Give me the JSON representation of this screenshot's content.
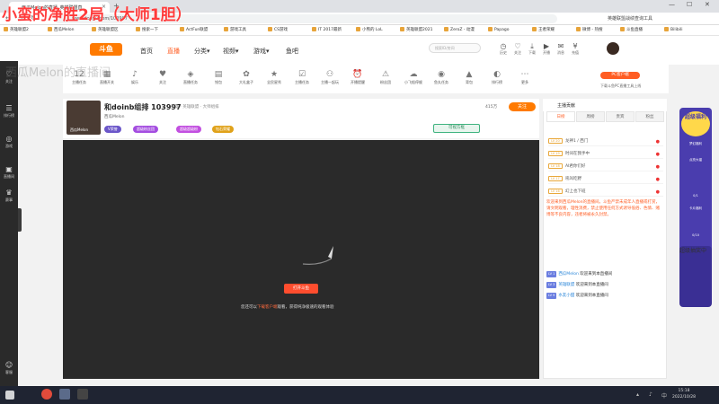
{
  "overlay": {
    "title": "小蛮的净胜2局（大师1胆）"
  },
  "browser": {
    "tab_title": "西瓜Melon的直播_英雄联盟直",
    "url": "www.douyu.com/103997",
    "search_hint": "英雄联盟战绩查询工具",
    "new_tab": "+",
    "close_glyph": "×",
    "minimize": "—",
    "maximize": "☐",
    "close_window": "✕"
  },
  "bookmarks": [
    "英雄联盟2",
    "西瓜Melon",
    "英雄联盟区",
    "搜索一下",
    "ActFun联盟",
    "游戏工具",
    "CS游戏",
    "IT 2017最新",
    "小熊的 LoL",
    "英雄联盟2021",
    "ZeroZ - 动漫",
    "Papago",
    "王者荣耀",
    "微博 - 热搜",
    "斗鱼直播",
    "Bilibili"
  ],
  "site": {
    "logo": "斗鱼",
    "nav": [
      "首页",
      "直播",
      "分类▾",
      "视频▾",
      "游戏▾",
      "鱼吧"
    ],
    "search_placeholder": "搜索ID/房间",
    "header_icons": [
      {
        "label": "历史",
        "glyph": "◷"
      },
      {
        "label": "关注",
        "glyph": "♡"
      },
      {
        "label": "下载",
        "glyph": "⤓"
      },
      {
        "label": "开播",
        "glyph": "▶"
      },
      {
        "label": "消息",
        "glyph": "✉"
      },
      {
        "label": "充值",
        "glyph": "¥"
      }
    ]
  },
  "sidebar": [
    {
      "label": "关注",
      "glyph": "♡"
    },
    {
      "label": "排行榜",
      "glyph": "☰"
    },
    {
      "label": "游戏",
      "glyph": "◎"
    },
    {
      "label": "直播间",
      "glyph": "▣"
    },
    {
      "label": "赛事",
      "glyph": "♛"
    },
    {
      "label": "客服",
      "glyph": "☺"
    }
  ],
  "watermark": "西瓜Melon的直播间",
  "categories": [
    {
      "label": "主播任务",
      "glyph": "12"
    },
    {
      "label": "直播开关",
      "glyph": "▦"
    },
    {
      "label": "娱乐",
      "glyph": "♪"
    },
    {
      "label": "关注",
      "glyph": "♥"
    },
    {
      "label": "直播任务",
      "glyph": "◈"
    },
    {
      "label": "钱包",
      "glyph": "▤"
    },
    {
      "label": "大礼盒子",
      "glyph": "✿"
    },
    {
      "label": "全民星秀",
      "glyph": "★"
    },
    {
      "label": "主播任务",
      "glyph": "☑"
    },
    {
      "label": "主播一起玩",
      "glyph": "⚇"
    },
    {
      "label": "开播提醒",
      "glyph": "⏰"
    },
    {
      "label": "粉丝团",
      "glyph": "⚠"
    },
    {
      "label": "小飞船停舰",
      "glyph": "☁"
    },
    {
      "label": "鱼丸任务",
      "glyph": "◉"
    },
    {
      "label": "背包",
      "glyph": "▲"
    },
    {
      "label": "排行榜",
      "glyph": "◐"
    },
    {
      "label": "更多",
      "glyph": "⋯"
    }
  ],
  "pc_client": {
    "button": "PC客户端",
    "sub": "下载斗鱼PC直播工具上线"
  },
  "streamer": {
    "room_title": "和doinb组排 103997",
    "tag": "英雄 · 英雄联盟 · 大师组排",
    "name": "西瓜Melon",
    "badges": [
      "V荣誉",
      "超级粉丝团",
      "超级超级粉",
      "钻石荣耀"
    ],
    "follow": "关注",
    "viewers": "415万",
    "hq_button": "可视方框"
  },
  "player": {
    "open_button": "打开斗鱼",
    "tip_prefix": "您还可以",
    "tip_link": "下载客户端",
    "tip_suffix": "观看，获得纯净极速的观看体验"
  },
  "right_panel": {
    "header": "主播贡献",
    "tabs": [
      "日榜",
      "周榜",
      "贵宾",
      "粉丝"
    ],
    "ranks": [
      {
        "level": "LV 20",
        "text": "龙神1 / 西门"
      },
      {
        "level": "LV 19",
        "text": "时间在我手中"
      },
      {
        "level": "LV 18",
        "text": "AI君你们好"
      },
      {
        "level": "LV 17",
        "text": "吼叫吃野"
      },
      {
        "level": "LV 16",
        "text": "幻上也下班"
      }
    ],
    "notice": "欢迎来到西瓜Melon的直播间。斗鱼严禁未成年人直播或打赏，请文明观看，理性消费，禁止使用任何方式诱导低俗、色情、赌博等不良内容，违者将被永久封禁。",
    "messages": [
      {
        "level": "LV 1",
        "user": "西瓜Melon",
        "text": "欢迎来到本直播间"
      },
      {
        "level": "LV 3",
        "user": "英雄联盟",
        "text": "欢迎来到本直播间"
      },
      {
        "level": "LV 9",
        "user": "水友小甜",
        "text": "欢迎来到本直播间"
      }
    ]
  },
  "promo": {
    "title": "超级福利",
    "items": [
      "梦幻福利",
      "点亮大锚",
      "0/1",
      "卡片福利",
      "0/10"
    ],
    "bottom": "超级抽奖中"
  },
  "taskbar": {
    "time": "15:18",
    "date": "2022/10/28"
  },
  "colors": {
    "accent": "#ff5d23",
    "player_bg": "#2a2a2a",
    "sidebar_bg": "#2a2a2a",
    "taskbar": "#1f2432"
  }
}
